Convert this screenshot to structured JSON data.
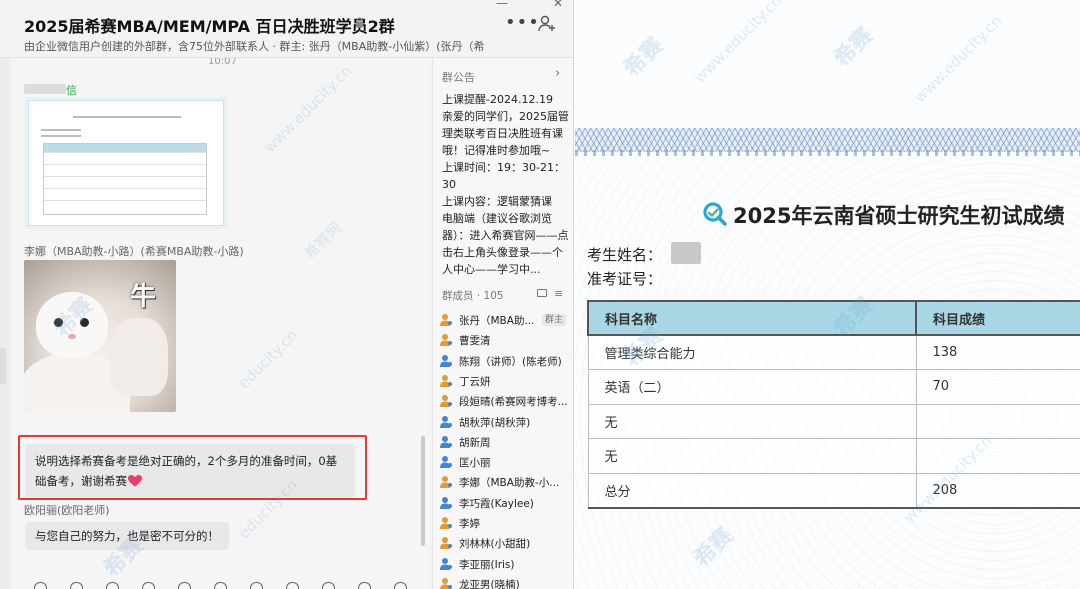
{
  "chat": {
    "title": "2025届希赛MBA/MEM/MPA 百日决胜班学员2群",
    "subtitle": "由企业微信用户创建的外部群，含75位外部联系人 · 群主: 张丹（MBA助教-小仙紫）(张丹（希赛MB...",
    "window_minimize": "—",
    "window_close": "✕",
    "timestamp": "10:07",
    "first_sender_suffix": "信",
    "sender_name": "李娜（MBA助教-小路）(希赛MBA助教-小路)",
    "sticker_text": "牛",
    "message_text": "说明选择希赛备考是绝对正确的，2个多月的准备时间，0基础备考，谢谢希赛",
    "sender_name2": "欧阳骊(欧阳老师)",
    "message_text2": "与您自己的努力，也是密不可分的！"
  },
  "side": {
    "notice_label": "群公告",
    "notice_arrow": "›",
    "notice_text": "上课提醒-2024.12.19\n亲爱的同学们，2025届管理类联考百日决胜班有课哦！记得准时参加哦~\n上课时间：19：30-21：30\n上课内容：逻辑蒙猜课\n电脑端（建议谷歌浏览器）：进入希赛官网——点击右上角头像登录——个人中心——学习中...",
    "members_label": "群成员 · 105",
    "owner_badge": "群主",
    "members": [
      {
        "name": "张丹（MBA助...",
        "color": "#e39a2f"
      },
      {
        "name": "曹雯清",
        "color": "#e39a2f"
      },
      {
        "name": "陈翔（讲师）(陈老师)",
        "color": "#3f86d4"
      },
      {
        "name": "丁云妍",
        "color": "#e39a2f"
      },
      {
        "name": "段姮晴(希赛网考博考...",
        "color": "#e39a2f"
      },
      {
        "name": "胡秋萍(胡秋萍)",
        "color": "#3f86d4"
      },
      {
        "name": "胡新周",
        "color": "#3f86d4"
      },
      {
        "name": "匡小丽",
        "color": "#3f86d4"
      },
      {
        "name": "李娜（MBA助教-小...",
        "color": "#e39a2f"
      },
      {
        "name": "李巧霞(Kaylee)",
        "color": "#3f86d4"
      },
      {
        "name": "李婷",
        "color": "#e39a2f"
      },
      {
        "name": "刘林林(小甜甜)",
        "color": "#e39a2f"
      },
      {
        "name": "李亚丽(Iris)",
        "color": "#3f86d4"
      },
      {
        "name": "龙亚男(晓楠)",
        "color": "#e39a2f"
      }
    ]
  },
  "doc": {
    "title": "2025年云南省硕士研究生初试成绩",
    "name_label": "考生姓名：",
    "id_label": "准考证号：",
    "table": {
      "headers": [
        "科目名称",
        "科目成绩"
      ],
      "rows": [
        [
          "管理类综合能力",
          "138"
        ],
        [
          "英语（二）",
          "70"
        ],
        [
          "无",
          ""
        ],
        [
          "无",
          ""
        ],
        [
          "总分",
          "208"
        ]
      ]
    }
  },
  "watermarks": {
    "brand": "希赛",
    "site": "www.educity.cn",
    "site_short": "educity.cn",
    "brand_net": "希赛网"
  },
  "colors": {
    "highlight": "#e53935",
    "header_blue": "#a9d7e5",
    "member_orange": "#e39a2f",
    "member_blue": "#3f86d4"
  }
}
